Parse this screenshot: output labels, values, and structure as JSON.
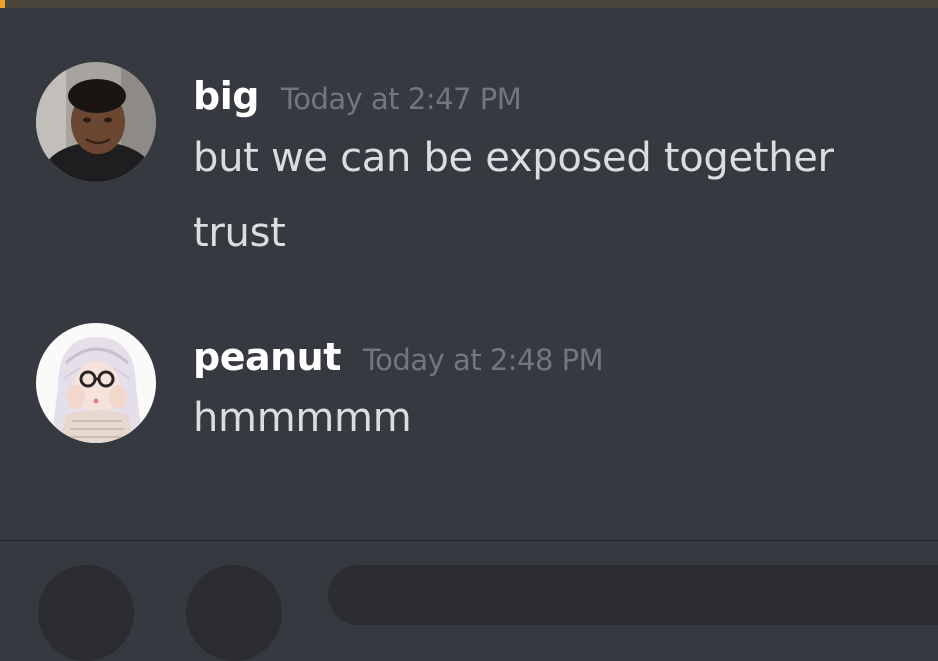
{
  "theme": {
    "background": "#36393f",
    "username_color": "#ffffff",
    "text_color": "#dcddde",
    "timestamp_color": "#72767d",
    "accent": "#f0a02c"
  },
  "messages": [
    {
      "username": "big",
      "timestamp": "Today at 2:47 PM",
      "avatar_icon": "user-photo-avatar",
      "lines": [
        "but we can be exposed together",
        "trust"
      ]
    },
    {
      "username": "peanut",
      "timestamp": "Today at 2:48 PM",
      "avatar_icon": "illustrated-girl-avatar",
      "lines": [
        "hmmmmm"
      ]
    }
  ]
}
